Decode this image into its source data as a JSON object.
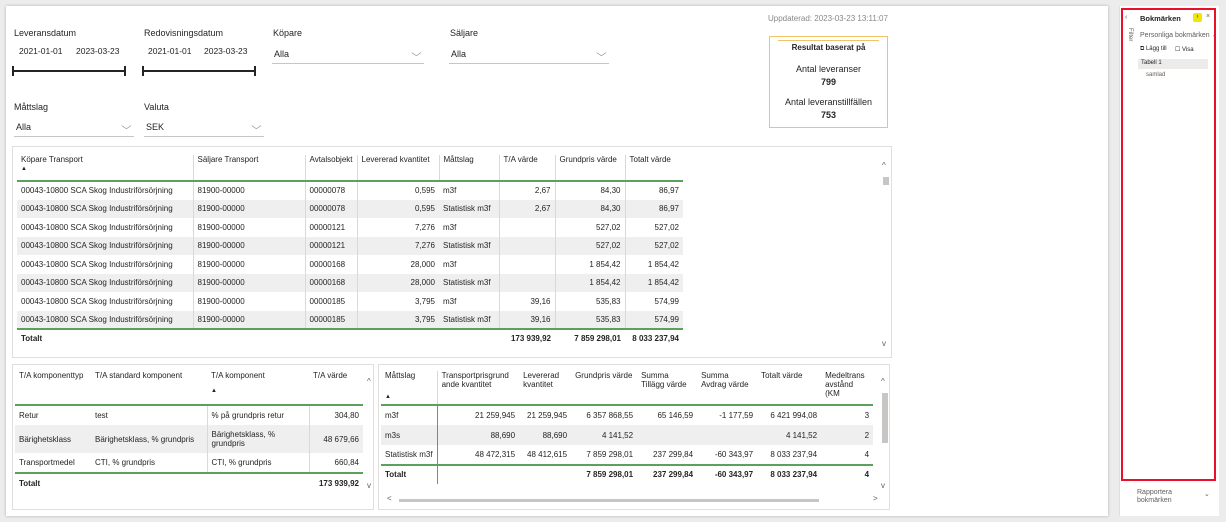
{
  "updated": "Uppdaterad: 2023-03-23 13:11:07",
  "filters": {
    "leveransdatum": {
      "label": "Leveransdatum",
      "from": "2021-01-01",
      "to": "2023-03-23"
    },
    "redovisningsdatum": {
      "label": "Redovisningsdatum",
      "from": "2021-01-01",
      "to": "2023-03-23"
    },
    "kopare": {
      "label": "Köpare",
      "value": "Alla"
    },
    "saljare": {
      "label": "Säljare",
      "value": "Alla"
    },
    "mattslag": {
      "label": "Måttslag",
      "value": "Alla"
    },
    "valuta": {
      "label": "Valuta",
      "value": "SEK"
    }
  },
  "result_card": {
    "title": "Resultat baserat på",
    "metric1_label": "Antal leveranser",
    "metric1_value": "799",
    "metric2_label": "Antal leveranstillfällen",
    "metric2_value": "753"
  },
  "main_table": {
    "columns": [
      "Köpare Transport",
      "Säljare Transport",
      "Avtalsobjekt",
      "Levererad kvantitet",
      "Måttslag",
      "T/A värde",
      "Grundpris värde",
      "Totalt värde"
    ],
    "rows": [
      [
        "00043-10800 SCA Skog Industriförsörjning",
        "81900-00000",
        "00000078",
        "0,595",
        "m3f",
        "2,67",
        "84,30",
        "86,97"
      ],
      [
        "00043-10800 SCA Skog Industriförsörjning",
        "81900-00000",
        "00000078",
        "0,595",
        "Statistisk m3f",
        "2,67",
        "84,30",
        "86,97"
      ],
      [
        "00043-10800 SCA Skog Industriförsörjning",
        "81900-00000",
        "00000121",
        "7,276",
        "m3f",
        "",
        "527,02",
        "527,02"
      ],
      [
        "00043-10800 SCA Skog Industriförsörjning",
        "81900-00000",
        "00000121",
        "7,276",
        "Statistisk m3f",
        "",
        "527,02",
        "527,02"
      ],
      [
        "00043-10800 SCA Skog Industriförsörjning",
        "81900-00000",
        "00000168",
        "28,000",
        "m3f",
        "",
        "1 854,42",
        "1 854,42"
      ],
      [
        "00043-10800 SCA Skog Industriförsörjning",
        "81900-00000",
        "00000168",
        "28,000",
        "Statistisk m3f",
        "",
        "1 854,42",
        "1 854,42"
      ],
      [
        "00043-10800 SCA Skog Industriförsörjning",
        "81900-00000",
        "00000185",
        "3,795",
        "m3f",
        "39,16",
        "535,83",
        "574,99"
      ],
      [
        "00043-10800 SCA Skog Industriförsörjning",
        "81900-00000",
        "00000185",
        "3,795",
        "Statistisk m3f",
        "39,16",
        "535,83",
        "574,99"
      ]
    ],
    "total": [
      "Totalt",
      "",
      "",
      "",
      "",
      "173 939,92",
      "7 859 298,01",
      "8 033 237,94"
    ]
  },
  "ta_table": {
    "columns": [
      "T/A komponenttyp",
      "T/A standard komponent",
      "T/A komponent",
      "T/A värde"
    ],
    "rows": [
      [
        "Retur",
        "test",
        "% på grundpris retur",
        "304,80"
      ],
      [
        "Bärighetsklass",
        "Bärighetsklass, % grundpris",
        "Bärighetsklass, % grundpris",
        "48 679,66"
      ],
      [
        "Transportmedel",
        "CTI, % grundpris",
        "CTI, % grundpris",
        "660,84"
      ]
    ],
    "total": [
      "Totalt",
      "",
      "",
      "173 939,92"
    ]
  },
  "matt_table": {
    "columns": [
      "Måttslag",
      "Transportprisgrund ande kvantitet",
      "Levererad kvantitet",
      "Grundpris värde",
      "Summa Tillägg värde",
      "Summa Avdrag värde",
      "Totalt värde",
      "Medeltrans avstånd (KM"
    ],
    "rows": [
      [
        "m3f",
        "21 259,945",
        "21 259,945",
        "6 357 868,55",
        "65 146,59",
        "-1 177,59",
        "6 421 994,08",
        "3"
      ],
      [
        "m3s",
        "88,690",
        "88,690",
        "4 141,52",
        "",
        "",
        "4 141,52",
        "2"
      ],
      [
        "Statistisk m3f",
        "48 472,315",
        "48 412,615",
        "7 859 298,01",
        "237 299,84",
        "-60 343,97",
        "8 033 237,94",
        "4"
      ]
    ],
    "total": [
      "Totalt",
      "",
      "",
      "7 859 298,01",
      "237 299,84",
      "-60 343,97",
      "8 033 237,94",
      "4"
    ]
  },
  "bookmarks": {
    "title": "Bokmärken",
    "filter_tab": "Filter",
    "section": "Personliga bokmärken",
    "add_label": "Lägg till",
    "view_label": "Visa",
    "item1": "Tabell 1",
    "item2": "samlad",
    "footer": "Rapportera bokmärken"
  }
}
